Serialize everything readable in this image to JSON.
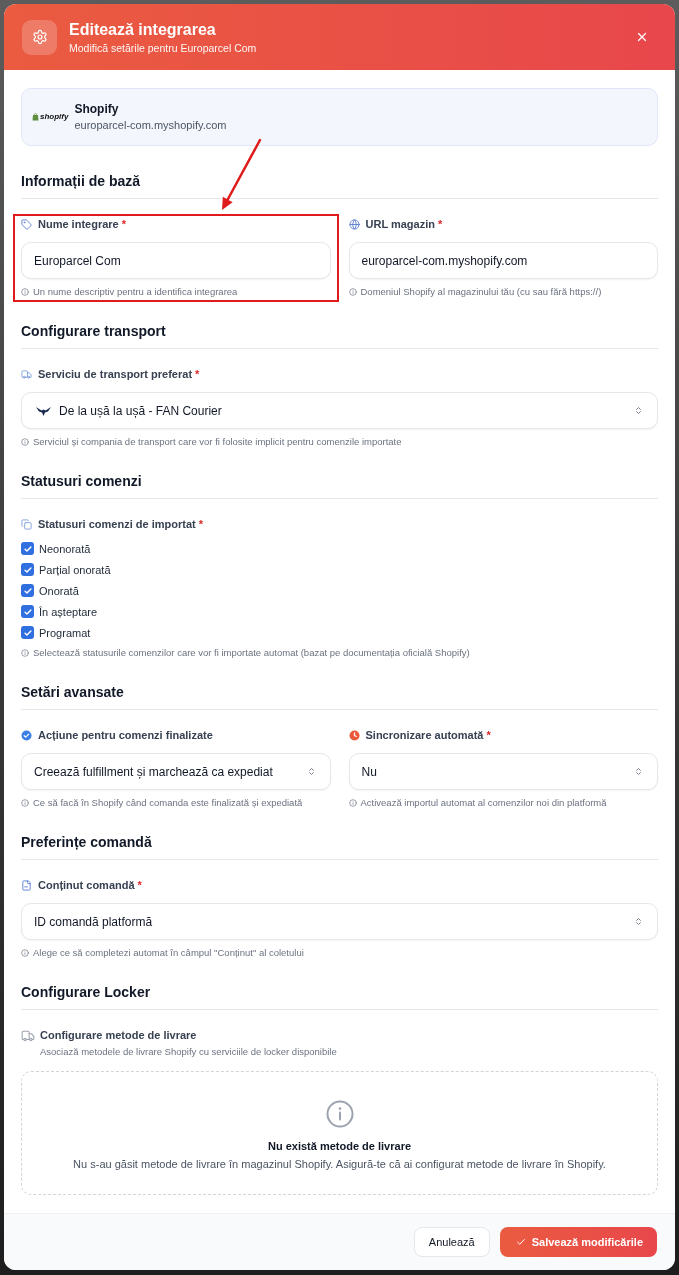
{
  "header": {
    "title": "Editează integrarea",
    "subtitle": "Modifică setările pentru Europarcel Com"
  },
  "platform_card": {
    "logo_text": "shopify",
    "name": "Shopify",
    "url": "europarcel-com.myshopify.com"
  },
  "sections": [
    {
      "title": "Informații de bază",
      "fields": [
        {
          "kind": "input",
          "label": "Nume integrare",
          "required_mark": "*",
          "value": "Europarcel Com",
          "hint": "Un nume descriptiv pentru a identifica integrarea"
        },
        {
          "kind": "input",
          "label": "URL magazin",
          "required_mark": "*",
          "value": "europarcel-com.myshopify.com",
          "hint": "Domeniul Shopify al magazinului tău (cu sau fără https://)"
        }
      ]
    },
    {
      "title": "Configurare transport",
      "fields": [
        {
          "kind": "courier_select",
          "label": "Serviciu de transport preferat",
          "required_mark": "*",
          "value": "De la ușă la ușă - FAN Courier",
          "hint": "Serviciul și compania de transport care vor fi folosite implicit pentru comenzile importate"
        }
      ]
    },
    {
      "title": "Statusuri comenzi",
      "fields": [
        {
          "kind": "checkboxes",
          "label": "Statusuri comenzi de importat",
          "required_mark": "*",
          "options": [
            {
              "label": "Neonorată",
              "checked": true
            },
            {
              "label": "Parțial onorată",
              "checked": true
            },
            {
              "label": "Onorată",
              "checked": true
            },
            {
              "label": "În așteptare",
              "checked": true
            },
            {
              "label": "Programat",
              "checked": true
            }
          ],
          "hint": "Selectează statusurile comenzilor care vor fi importate automat (bazat pe documentația oficială Shopify)"
        }
      ]
    },
    {
      "title": "Setări avansate",
      "fields": [
        {
          "kind": "select",
          "label": "Acțiune pentru comenzi finalizate",
          "value": "Creează fulfillment și marchează ca expediat",
          "hint": "Ce să facă în Shopify când comanda este finalizată și expediată"
        },
        {
          "kind": "select",
          "label": "Sincronizare automată",
          "required_mark": "*",
          "value": "Nu",
          "hint": "Activează importul automat al comenzilor noi din platformă"
        }
      ]
    },
    {
      "title": "Preferințe comandă",
      "fields": [
        {
          "kind": "select",
          "label": "Conținut comandă",
          "required_mark": "*",
          "value": "ID comandă platformă",
          "hint": "Alege ce să completezi automat în câmpul \"Conținut\" al coletului"
        }
      ]
    },
    {
      "title": "Configurare Locker",
      "fields": [
        {
          "kind": "mapping",
          "label": "Configurare metode de livrare",
          "description": "Asociază metodele de livrare Shopify cu serviciile de locker disponibile",
          "empty_state": {
            "title": "Nu există metode de livrare",
            "message": "Nu s-au găsit metode de livrare în magazinul Shopify. Asigură-te că ai configurat metode de livrare în Shopify."
          }
        }
      ]
    }
  ],
  "footer": {
    "buttons": [
      {
        "label": "Anulează",
        "kind": "secondary"
      },
      {
        "label": "Salvează modificările",
        "kind": "primary"
      }
    ]
  }
}
